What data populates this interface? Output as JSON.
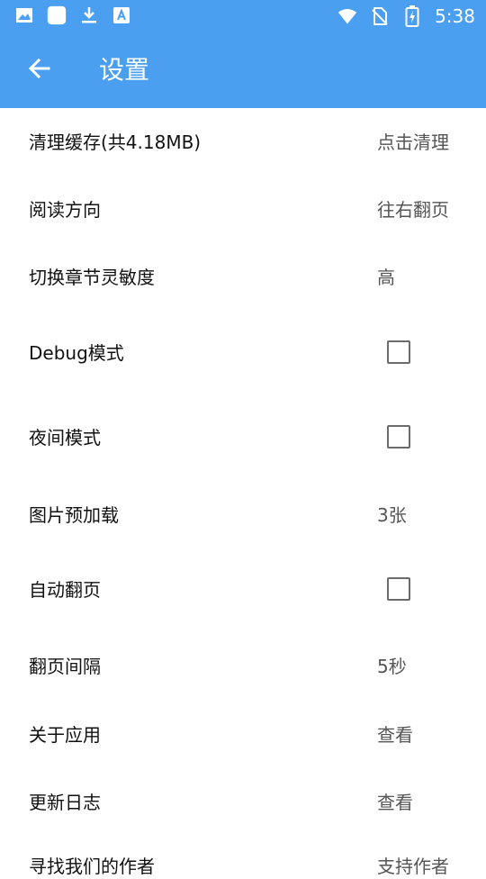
{
  "status_bar": {
    "time": "5:38",
    "icons_left": [
      "image-icon",
      "app-square-icon",
      "download-icon",
      "store-icon"
    ],
    "icons_right": [
      "wifi-icon",
      "no-sim-icon",
      "battery-charging-icon"
    ]
  },
  "toolbar": {
    "title": "设置",
    "back_icon": "arrow-left-icon"
  },
  "settings": {
    "items": [
      {
        "label": "清理缓存(共4.18MB)",
        "value": "点击清理"
      },
      {
        "label": "阅读方向",
        "value": "往右翻页"
      },
      {
        "label": "切换章节灵敏度",
        "value": "高"
      },
      {
        "label": "Debug模式",
        "checked": false
      },
      {
        "label": "夜间模式",
        "checked": false
      },
      {
        "label": "图片预加载",
        "value": "3张"
      },
      {
        "label": "自动翻页",
        "checked": false
      },
      {
        "label": "翻页间隔",
        "value": "5秒"
      },
      {
        "label": "关于应用",
        "value": "查看"
      },
      {
        "label": "更新日志",
        "value": "查看"
      },
      {
        "label": "寻找我们的作者",
        "value": "支持作者"
      }
    ]
  },
  "colors": {
    "primary": "#4a9ff0",
    "text": "#111111",
    "secondary_text": "#555555",
    "checkbox_border": "#6b6b6b"
  }
}
